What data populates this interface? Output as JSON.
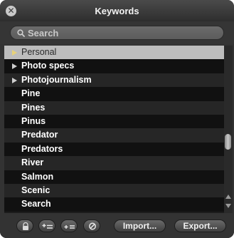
{
  "window": {
    "title": "Keywords"
  },
  "search": {
    "placeholder": "Search",
    "value": ""
  },
  "keywords": [
    {
      "label": "Personal",
      "expandable": true,
      "selected": true
    },
    {
      "label": "Photo specs",
      "expandable": true,
      "selected": false
    },
    {
      "label": "Photojournalism",
      "expandable": true,
      "selected": false
    },
    {
      "label": "Pine",
      "expandable": false,
      "selected": false
    },
    {
      "label": "Pines",
      "expandable": false,
      "selected": false
    },
    {
      "label": "Pinus",
      "expandable": false,
      "selected": false
    },
    {
      "label": "Predator",
      "expandable": false,
      "selected": false
    },
    {
      "label": "Predators",
      "expandable": false,
      "selected": false
    },
    {
      "label": "River",
      "expandable": false,
      "selected": false
    },
    {
      "label": "Salmon",
      "expandable": false,
      "selected": false
    },
    {
      "label": "Scenic",
      "expandable": false,
      "selected": false
    },
    {
      "label": "Search",
      "expandable": false,
      "selected": false
    }
  ],
  "toolbar": {
    "lock_icon": "lock-icon",
    "add_child_icon": "add-keyword-child-icon",
    "add_sibling_icon": "add-keyword-sibling-icon",
    "delete_icon": "delete-keyword-icon",
    "import_label": "Import...",
    "export_label": "Export..."
  }
}
